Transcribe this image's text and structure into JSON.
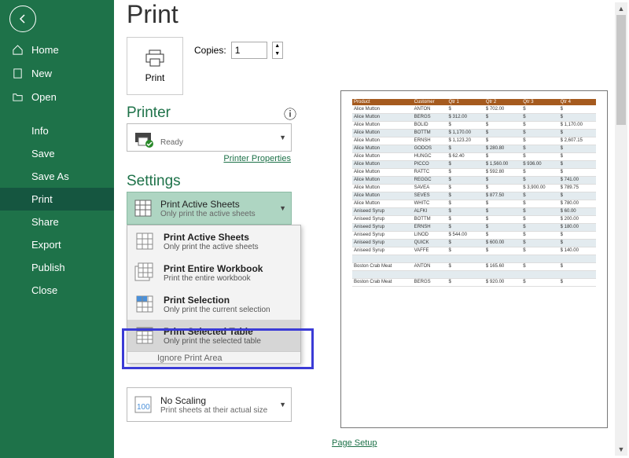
{
  "sidebar": {
    "home": "Home",
    "new": "New",
    "open": "Open",
    "info": "Info",
    "save": "Save",
    "saveAs": "Save As",
    "print": "Print",
    "share": "Share",
    "export": "Export",
    "publish": "Publish",
    "close": "Close"
  },
  "title": "Print",
  "printBtn": "Print",
  "copiesLabel": "Copies:",
  "copiesValue": "1",
  "printerLabel": "Printer",
  "printerStatus": "Ready",
  "printerProps": "Printer Properties",
  "settingsLabel": "Settings",
  "currentSetting": {
    "title": "Print Active Sheets",
    "sub": "Only print the active sheets"
  },
  "options": [
    {
      "title": "Print Active Sheets",
      "sub": "Only print the active sheets"
    },
    {
      "title": "Print Entire Workbook",
      "sub": "Print the entire workbook"
    },
    {
      "title": "Print Selection",
      "sub": "Only print the current selection"
    },
    {
      "title": "Print Selected Table",
      "sub": "Only print the selected table"
    }
  ],
  "ignore": "Ignore Print Area",
  "scaling": {
    "title": "No Scaling",
    "sub": "Print sheets at their actual size"
  },
  "pageSetup": "Page Setup",
  "preview": {
    "headers": [
      "Product",
      "Customer",
      "Qtr 1",
      "Qtr 2",
      "Qtr 3",
      "Qtr 4"
    ],
    "rows": [
      [
        "Alice Mutton",
        "ANTON",
        "$",
        "$   702.00",
        "$",
        "$"
      ],
      [
        "Alice Mutton",
        "BERGS",
        "$   312.00",
        "$",
        "$",
        "$"
      ],
      [
        "Alice Mutton",
        "BOLID",
        "$",
        "$",
        "$",
        "$ 1,170.00"
      ],
      [
        "Alice Mutton",
        "BOTTM",
        "$ 1,170.00",
        "$",
        "$",
        "$"
      ],
      [
        "Alice Mutton",
        "ERNSH",
        "$ 1,123.20",
        "$",
        "$",
        "$ 2,607.15"
      ],
      [
        "Alice Mutton",
        "GODOS",
        "$",
        "$   280.80",
        "$",
        "$"
      ],
      [
        "Alice Mutton",
        "HUNGC",
        "$    62.40",
        "$",
        "$",
        "$"
      ],
      [
        "Alice Mutton",
        "PICCO",
        "$",
        "$ 1,560.00",
        "$   936.00",
        "$"
      ],
      [
        "Alice Mutton",
        "RATTC",
        "$",
        "$   592.80",
        "$",
        "$"
      ],
      [
        "Alice Mutton",
        "REGGC",
        "$",
        "$",
        "$",
        "$   741.00"
      ],
      [
        "Alice Mutton",
        "SAVEA",
        "$",
        "$",
        "$ 3,900.00",
        "$   789.75"
      ],
      [
        "Alice Mutton",
        "SEVES",
        "$",
        "$   877.50",
        "$",
        "$"
      ],
      [
        "Alice Mutton",
        "WHITC",
        "$",
        "$",
        "$",
        "$   780.00"
      ],
      [
        "Aniseed Syrup",
        "ALFKI",
        "$",
        "$",
        "$",
        "$    60.00"
      ],
      [
        "Aniseed Syrup",
        "BOTTM",
        "$",
        "$",
        "$",
        "$   200.00"
      ],
      [
        "Aniseed Syrup",
        "ERNSH",
        "$",
        "$",
        "$",
        "$   180.00"
      ],
      [
        "Aniseed Syrup",
        "LINOD",
        "$   544.00",
        "$",
        "$",
        "$"
      ],
      [
        "Aniseed Syrup",
        "QUICK",
        "$",
        "$   600.00",
        "$",
        "$"
      ],
      [
        "Aniseed Syrup",
        "VAFFE",
        "$",
        "$",
        "$",
        "$   140.00"
      ],
      [
        "",
        "",
        "",
        "",
        "",
        ""
      ],
      [
        "Boston Crab Meat",
        "ANTON",
        "$",
        "$   165.60",
        "$",
        "$"
      ],
      [
        "",
        "",
        "",
        "",
        "",
        ""
      ],
      [
        "Boston Crab Meat",
        "BERGS",
        "$",
        "$   920.00",
        "$",
        "$"
      ]
    ]
  }
}
